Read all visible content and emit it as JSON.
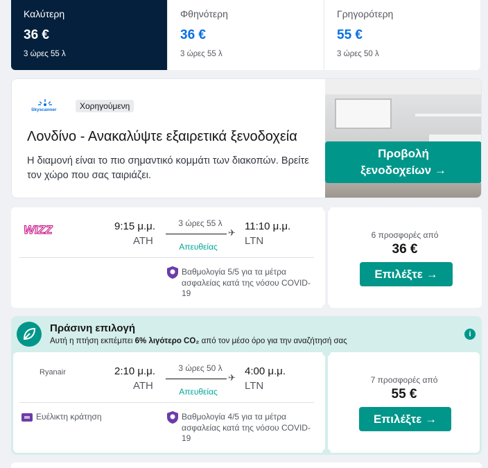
{
  "sort_tabs": [
    {
      "label": "Καλύτερη",
      "price": "36 €",
      "duration": "3 ώρες 55 λ"
    },
    {
      "label": "Φθηνότερη",
      "price": "36 €",
      "duration": "3 ώρες 55 λ"
    },
    {
      "label": "Γρηγορότερη",
      "price": "55 €",
      "duration": "3 ώρες 50 λ"
    }
  ],
  "ad": {
    "logo_text": "Skyscanner",
    "badge": "Χορηγούμενη",
    "title": "Λονδίνο - Ανακαλύψτε εξαιρετικά ξενοδοχεία",
    "text": "Η διαμονή είναι το πιο σημαντικό κομμάτι των διακοπών. Βρείτε τον χώρο που σας ταιριάζει.",
    "button_line1": "Προβολή",
    "button_line2": "ξενοδοχείων →"
  },
  "flights": [
    {
      "airline": "WIZZ",
      "depart_time": "9:15 μ.μ.",
      "depart_code": "ATH",
      "arrive_time": "11:10 μ.μ.",
      "arrive_code": "LTN",
      "duration": "3 ώρες 55 λ",
      "stops": "Απευθείας",
      "covid": "Βαθμολογία 5/5 για τα μέτρα ασφαλείας κατά της νόσου COVID-19",
      "offers": "6 προσφορές από",
      "price": "36 €",
      "select": "Επιλέξτε →"
    },
    {
      "airline": "Ryanair",
      "depart_time": "2:10 μ.μ.",
      "depart_code": "ATH",
      "arrive_time": "4:00 μ.μ.",
      "arrive_code": "LTN",
      "duration": "3 ώρες 50 λ",
      "stops": "Απευθείας",
      "flexible": "Ευέλικτη κράτηση",
      "covid": "Βαθμολογία 4/5 για τα μέτρα ασφαλείας κατά της νόσου COVID-19",
      "offers": "7 προσφορές από",
      "price": "55 €",
      "select": "Επιλέξτε →"
    }
  ],
  "green_choice": {
    "title": "Πράσινη επιλογή",
    "sub_prefix": "Αυτή η πτήση εκπέμπει ",
    "sub_bold": "6% λιγότερο CO₂",
    "sub_suffix": " από τον μέσο όρο για την αναζήτησή σας",
    "info": "i"
  },
  "colors": {
    "accent": "#00968a",
    "brand_dark": "#05203c",
    "link": "#0770e3",
    "wizz": "#c6007e",
    "green_bg": "#d4eeeb"
  }
}
